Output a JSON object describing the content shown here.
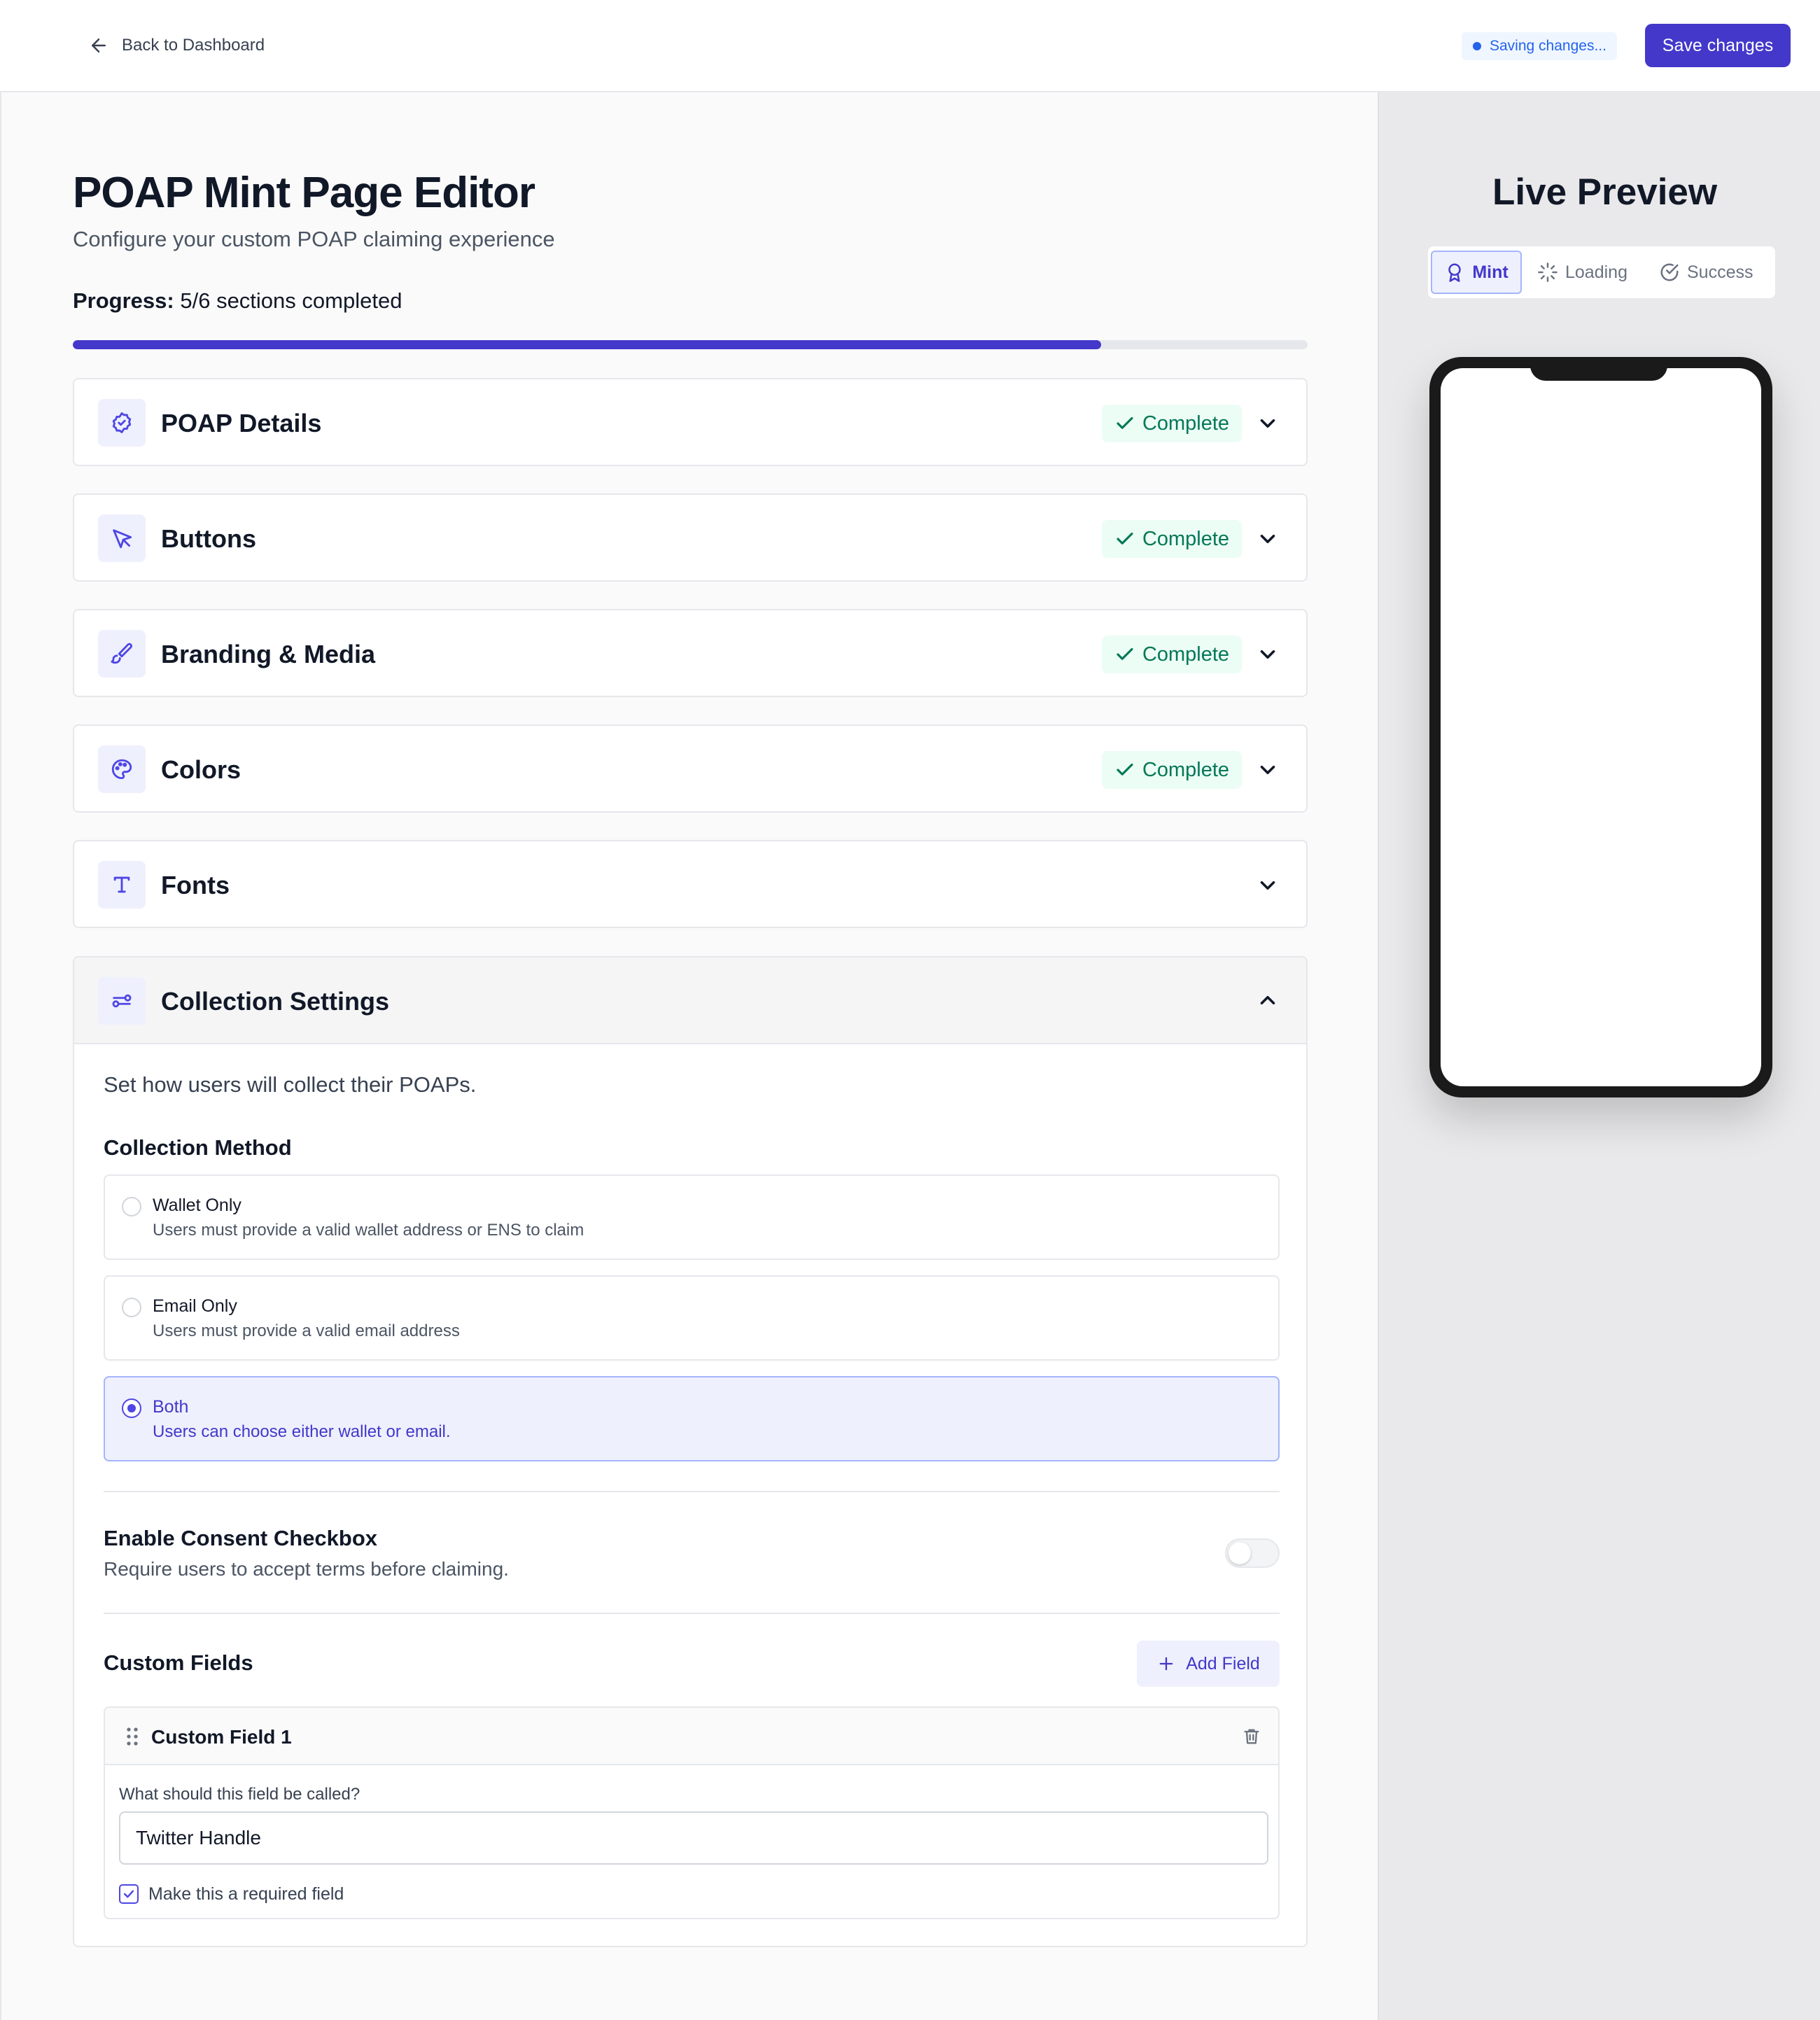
{
  "topbar": {
    "back_label": "Back to Dashboard",
    "saving_label": "Saving changes...",
    "save_label": "Save changes"
  },
  "editor": {
    "title": "POAP Mint Page Editor",
    "subtitle": "Configure your custom POAP claiming experience",
    "progress": {
      "label": "Progress:",
      "text": "5/6 sections completed",
      "completed": 5,
      "total": 6,
      "fill_percent": 83.3
    },
    "sections": [
      {
        "name": "POAP Details",
        "icon": "badge-check-icon",
        "status": "Complete"
      },
      {
        "name": "Buttons",
        "icon": "cursor-pointer-icon",
        "status": "Complete"
      },
      {
        "name": "Branding & Media",
        "icon": "paintbrush-icon",
        "status": "Complete"
      },
      {
        "name": "Colors",
        "icon": "palette-icon",
        "status": "Complete"
      },
      {
        "name": "Fonts",
        "icon": "type-icon",
        "status": ""
      }
    ],
    "collection": {
      "name": "Collection Settings",
      "icon": "sliders-icon",
      "description": "Set how users will collect their POAPs.",
      "method_label": "Collection Method",
      "options": [
        {
          "title": "Wallet Only",
          "description": "Users must provide a valid wallet address or ENS to claim",
          "selected": false
        },
        {
          "title": "Email Only",
          "description": "Users must provide a valid email address",
          "selected": false
        },
        {
          "title": "Both",
          "description": "Users can choose either wallet or email.",
          "selected": true
        }
      ],
      "consent": {
        "title": "Enable Consent Checkbox",
        "description": "Require users to accept terms before claiming.",
        "enabled": false
      },
      "custom_fields": {
        "title": "Custom Fields",
        "add_label": "Add Field",
        "fields": [
          {
            "name": "Custom Field 1",
            "question": "What should this field be called?",
            "value": "Twitter Handle",
            "required_label": "Make this a required field",
            "required": true
          }
        ]
      }
    }
  },
  "preview": {
    "title": "Live Preview",
    "tabs": [
      {
        "label": "Mint",
        "icon": "award-icon",
        "active": true
      },
      {
        "label": "Loading",
        "icon": "loader-icon",
        "active": false
      },
      {
        "label": "Success",
        "icon": "check-circle-icon",
        "active": false
      }
    ]
  },
  "colors": {
    "accent": "#4338ca",
    "success": "#047857",
    "saving": "#2563eb"
  }
}
